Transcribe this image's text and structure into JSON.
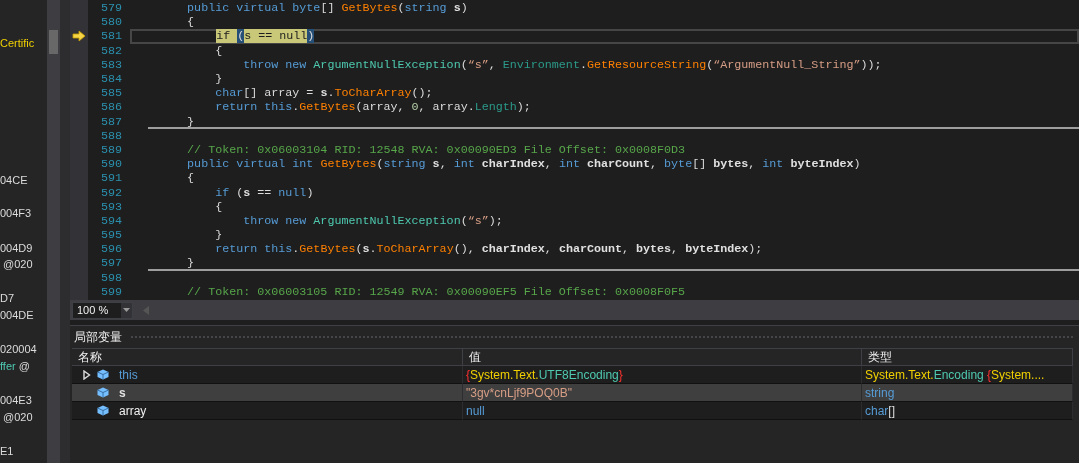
{
  "side_fragments": [
    [
      {
        "kind": "yellow",
        "text": "Certific"
      }
    ],
    [
      {
        "kind": "plain",
        "text": "04CE"
      }
    ],
    [
      {
        "kind": "plain",
        "text": "004F3"
      }
    ],
    [
      {
        "kind": "plain",
        "text": "004D9"
      }
    ],
    [
      {
        "kind": "plain",
        "text": " @020"
      }
    ],
    [
      {
        "kind": "plain",
        "text": "D7"
      }
    ],
    [
      {
        "kind": "plain",
        "text": "004DE"
      }
    ],
    [
      {
        "kind": "plain",
        "text": "020004"
      }
    ],
    [
      {
        "kind": "teal",
        "text": "ffer"
      },
      {
        "kind": "plain",
        "text": " @"
      }
    ],
    [
      {
        "kind": "plain",
        "text": "004E3"
      }
    ],
    [
      {
        "kind": "plain",
        "text": " @020"
      }
    ],
    [
      {
        "kind": "plain",
        "text": "E1"
      }
    ]
  ],
  "editor": {
    "lines": [
      {
        "number": "579",
        "current": false,
        "separator_after": false,
        "tokens": [
          {
            "kind": "kw",
            "text": "        public virtual byte"
          },
          {
            "kind": "plain",
            "text": "[] "
          },
          {
            "kind": "method",
            "text": "GetBytes"
          },
          {
            "kind": "plain",
            "text": "("
          },
          {
            "kind": "kw",
            "text": "string"
          },
          {
            "kind": "param",
            "text": " s"
          },
          {
            "kind": "plain",
            "text": ")"
          }
        ]
      },
      {
        "number": "580",
        "current": false,
        "separator_after": false,
        "tokens": [
          {
            "kind": "plain",
            "text": "        {"
          }
        ]
      },
      {
        "number": "581",
        "current": true,
        "separator_after": false,
        "tokens": [
          {
            "kind": "hl",
            "text": "            if "
          },
          {
            "kind": "brace",
            "text": "("
          },
          {
            "kind": "hl",
            "text": "s == null"
          },
          {
            "kind": "brace",
            "text": ")"
          }
        ]
      },
      {
        "number": "582",
        "current": false,
        "separator_after": false,
        "tokens": [
          {
            "kind": "plain",
            "text": "            {"
          }
        ]
      },
      {
        "number": "583",
        "current": false,
        "separator_after": false,
        "tokens": [
          {
            "kind": "kw",
            "text": "                throw new "
          },
          {
            "kind": "cls",
            "text": "ArgumentNullException"
          },
          {
            "kind": "plain",
            "text": "("
          },
          {
            "kind": "str",
            "text": "“s”"
          },
          {
            "kind": "plain",
            "text": ", "
          },
          {
            "kind": "cls2",
            "text": "Environment"
          },
          {
            "kind": "plain",
            "text": "."
          },
          {
            "kind": "method",
            "text": "GetResourceString"
          },
          {
            "kind": "plain",
            "text": "("
          },
          {
            "kind": "str",
            "text": "“ArgumentNull_String”"
          },
          {
            "kind": "plain",
            "text": "));"
          }
        ]
      },
      {
        "number": "584",
        "current": false,
        "separator_after": false,
        "tokens": [
          {
            "kind": "plain",
            "text": "            }"
          }
        ]
      },
      {
        "number": "585",
        "current": false,
        "separator_after": false,
        "tokens": [
          {
            "kind": "kw",
            "text": "            char"
          },
          {
            "kind": "plain",
            "text": "[] array = "
          },
          {
            "kind": "param",
            "text": "s"
          },
          {
            "kind": "plain",
            "text": "."
          },
          {
            "kind": "method",
            "text": "ToCharArray"
          },
          {
            "kind": "plain",
            "text": "();"
          }
        ]
      },
      {
        "number": "586",
        "current": false,
        "separator_after": false,
        "tokens": [
          {
            "kind": "kw",
            "text": "            return this"
          },
          {
            "kind": "plain",
            "text": "."
          },
          {
            "kind": "method",
            "text": "GetBytes"
          },
          {
            "kind": "plain",
            "text": "(array, "
          },
          {
            "kind": "num",
            "text": "0"
          },
          {
            "kind": "plain",
            "text": ", array."
          },
          {
            "kind": "cls2",
            "text": "Length"
          },
          {
            "kind": "plain",
            "text": ");"
          }
        ]
      },
      {
        "number": "587",
        "current": false,
        "separator_after": true,
        "tokens": [
          {
            "kind": "plain",
            "text": "        }"
          }
        ]
      },
      {
        "number": "588",
        "current": false,
        "separator_after": false
      },
      {
        "number": "589",
        "current": false,
        "separator_after": false,
        "tokens": [
          {
            "kind": "cmt",
            "text": "        // Token: 0x06003104 RID: 12548 RVA: 0x00090ED3 File Offset: 0x0008F0D3"
          }
        ]
      },
      {
        "number": "590",
        "current": false,
        "separator_after": false,
        "tokens": [
          {
            "kind": "kw",
            "text": "        public virtual int "
          },
          {
            "kind": "method",
            "text": "GetBytes"
          },
          {
            "kind": "plain",
            "text": "("
          },
          {
            "kind": "kw",
            "text": "string"
          },
          {
            "kind": "param",
            "text": " s"
          },
          {
            "kind": "plain",
            "text": ", "
          },
          {
            "kind": "kw",
            "text": "int"
          },
          {
            "kind": "param",
            "text": " charIndex"
          },
          {
            "kind": "plain",
            "text": ", "
          },
          {
            "kind": "kw",
            "text": "int"
          },
          {
            "kind": "param",
            "text": " charCount"
          },
          {
            "kind": "plain",
            "text": ", "
          },
          {
            "kind": "kw",
            "text": "byte"
          },
          {
            "kind": "plain",
            "text": "[]"
          },
          {
            "kind": "param",
            "text": " bytes"
          },
          {
            "kind": "plain",
            "text": ", "
          },
          {
            "kind": "kw",
            "text": "int"
          },
          {
            "kind": "param",
            "text": " byteIndex"
          },
          {
            "kind": "plain",
            "text": ")"
          }
        ]
      },
      {
        "number": "591",
        "current": false,
        "separator_after": false,
        "tokens": [
          {
            "kind": "plain",
            "text": "        {"
          }
        ]
      },
      {
        "number": "592",
        "current": false,
        "separator_after": false,
        "tokens": [
          {
            "kind": "kw",
            "text": "            if"
          },
          {
            "kind": "plain",
            "text": " ("
          },
          {
            "kind": "param",
            "text": "s"
          },
          {
            "kind": "plain",
            "text": " == "
          },
          {
            "kind": "kw",
            "text": "null"
          },
          {
            "kind": "plain",
            "text": ")"
          }
        ]
      },
      {
        "number": "593",
        "current": false,
        "separator_after": false,
        "tokens": [
          {
            "kind": "plain",
            "text": "            {"
          }
        ]
      },
      {
        "number": "594",
        "current": false,
        "separator_after": false,
        "tokens": [
          {
            "kind": "kw",
            "text": "                throw new "
          },
          {
            "kind": "cls",
            "text": "ArgumentNullException"
          },
          {
            "kind": "plain",
            "text": "("
          },
          {
            "kind": "str",
            "text": "“s”"
          },
          {
            "kind": "plain",
            "text": ");"
          }
        ]
      },
      {
        "number": "595",
        "current": false,
        "separator_after": false,
        "tokens": [
          {
            "kind": "plain",
            "text": "            }"
          }
        ]
      },
      {
        "number": "596",
        "current": false,
        "separator_after": false,
        "tokens": [
          {
            "kind": "kw",
            "text": "            return this"
          },
          {
            "kind": "plain",
            "text": "."
          },
          {
            "kind": "method",
            "text": "GetBytes"
          },
          {
            "kind": "plain",
            "text": "("
          },
          {
            "kind": "param",
            "text": "s"
          },
          {
            "kind": "plain",
            "text": "."
          },
          {
            "kind": "method",
            "text": "ToCharArray"
          },
          {
            "kind": "plain",
            "text": "(), "
          },
          {
            "kind": "param",
            "text": "charIndex"
          },
          {
            "kind": "plain",
            "text": ", "
          },
          {
            "kind": "param",
            "text": "charCount"
          },
          {
            "kind": "plain",
            "text": ", "
          },
          {
            "kind": "param",
            "text": "bytes"
          },
          {
            "kind": "plain",
            "text": ", "
          },
          {
            "kind": "param",
            "text": "byteIndex"
          },
          {
            "kind": "plain",
            "text": ");"
          }
        ]
      },
      {
        "number": "597",
        "current": false,
        "separator_after": true,
        "tokens": [
          {
            "kind": "plain",
            "text": "        }"
          }
        ]
      },
      {
        "number": "598",
        "current": false,
        "separator_after": false
      },
      {
        "number": "599",
        "current": false,
        "separator_after": false,
        "tokens": [
          {
            "kind": "cmt",
            "text": "        // Token: 0x06003105 RID: 12549 RVA: 0x00090EF5 File Offset: 0x0008F0F5"
          }
        ]
      }
    ]
  },
  "zoom": {
    "value": "100 %"
  },
  "locals": {
    "title": "局部变量",
    "columns": [
      "名称",
      "值",
      "类型"
    ],
    "rows": [
      {
        "name": [
          {
            "kind": "kw",
            "text": "this"
          }
        ],
        "expanded": false,
        "selected": false,
        "value": [
          {
            "kind": "brace",
            "text": "{"
          },
          {
            "kind": "yellow",
            "text": "System.Text."
          },
          {
            "kind": "teal",
            "text": "UTF8Encoding"
          },
          {
            "kind": "brace",
            "text": "}"
          }
        ],
        "type": [
          {
            "kind": "yellow",
            "text": "System.Text."
          },
          {
            "kind": "teal",
            "text": "Encoding"
          },
          {
            "kind": "brace",
            "text": " {"
          },
          {
            "kind": "yellow",
            "text": "System...."
          }
        ]
      },
      {
        "name": [
          {
            "kind": "param",
            "text": "s"
          }
        ],
        "selected": true,
        "value": [
          {
            "kind": "str",
            "text": "\"3gv*cnLjf9POQ0B\""
          }
        ],
        "type": [
          {
            "kind": "kw",
            "text": "string"
          }
        ]
      },
      {
        "name": [
          {
            "kind": "plain",
            "text": "array"
          }
        ],
        "selected": false,
        "value": [
          {
            "kind": "kw",
            "text": "null"
          }
        ],
        "type": [
          {
            "kind": "kw",
            "text": "char"
          },
          {
            "kind": "plain",
            "text": "[]"
          }
        ]
      }
    ]
  }
}
